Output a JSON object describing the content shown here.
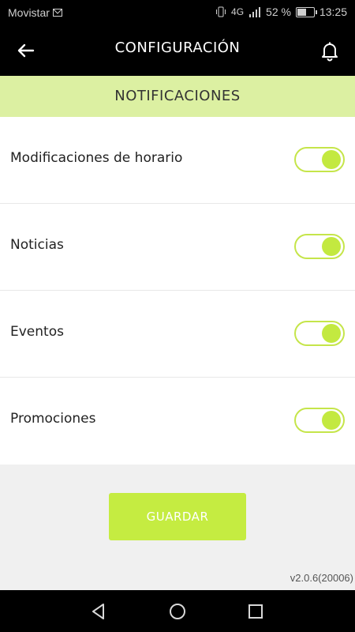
{
  "status_bar": {
    "carrier": "Movistar",
    "network": "4G",
    "battery": "52 %",
    "time": "13:25"
  },
  "header": {
    "title": "CONFIGURACIÓN",
    "back_icon": "arrow-left-icon",
    "bell_icon": "bell-icon"
  },
  "section": {
    "title": "NOTIFICACIONES"
  },
  "settings": [
    {
      "label": "Modificaciones de horario",
      "enabled": true
    },
    {
      "label": "Noticias",
      "enabled": true
    },
    {
      "label": "Eventos",
      "enabled": true
    },
    {
      "label": "Promociones",
      "enabled": true
    }
  ],
  "save_label": "GUARDAR",
  "version": "v2.0.6(20006)",
  "colors": {
    "accent": "#c5ec41",
    "section_bg": "#dcf0a2",
    "bar_bg": "#000000"
  }
}
